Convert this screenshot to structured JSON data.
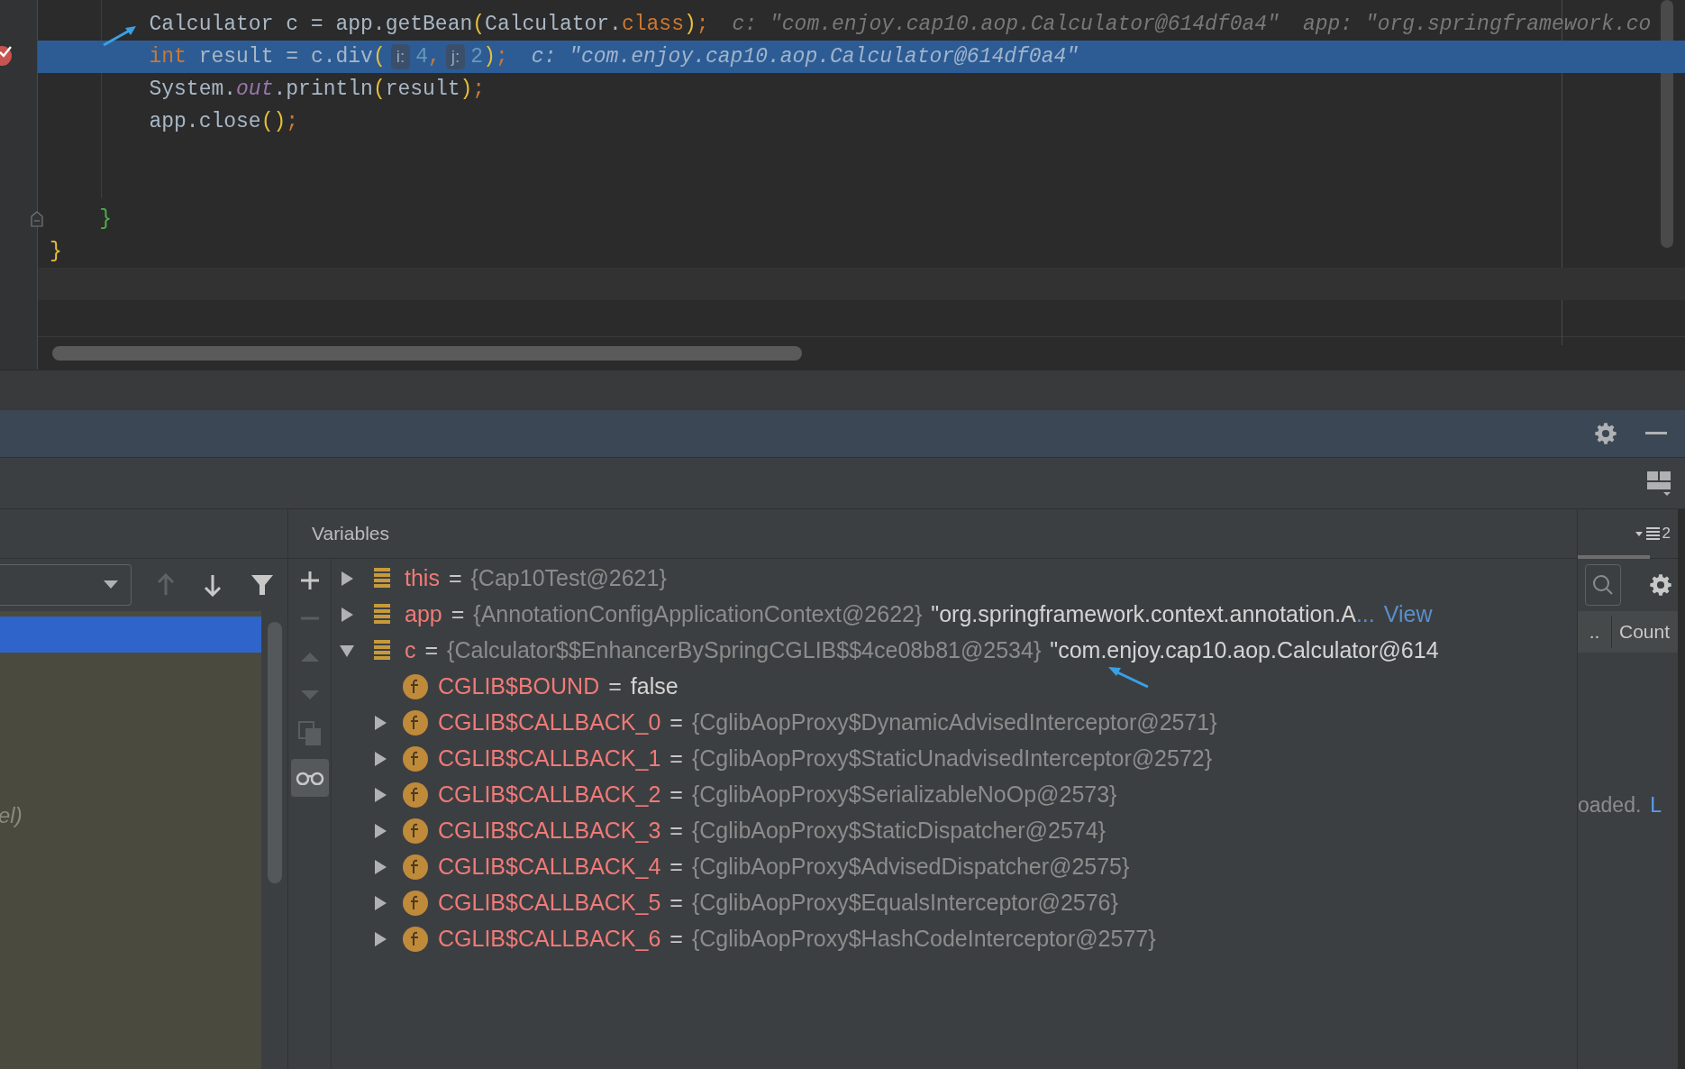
{
  "editor": {
    "lines": [
      {
        "highlighted": false,
        "tokens": [
          {
            "kind": "code",
            "text": "        Calculator c = app.getBean"
          },
          {
            "kind": "paren",
            "text": "("
          },
          {
            "kind": "code",
            "text": "Calculator."
          },
          {
            "kind": "keyword",
            "text": "class"
          },
          {
            "kind": "paren",
            "text": ")"
          },
          {
            "kind": "keyword",
            "text": ";"
          },
          {
            "kind": "inline_value",
            "text": "c: \"com.enjoy.cap10.aop.Calculator@614df0a4\""
          },
          {
            "kind": "inline_value",
            "text": "app: \"org.springframework.co"
          }
        ]
      },
      {
        "highlighted": true,
        "tokens": [
          {
            "kind": "keyword",
            "text": "        int"
          },
          {
            "kind": "code",
            "text": " result = c.div"
          },
          {
            "kind": "paren",
            "text": "("
          },
          {
            "kind": "param_hint",
            "text": "i:"
          },
          {
            "kind": "number",
            "text": "4"
          },
          {
            "kind": "keyword",
            "text": ","
          },
          {
            "kind": "param_hint",
            "text": "j:"
          },
          {
            "kind": "number",
            "text": "2"
          },
          {
            "kind": "paren",
            "text": ")"
          },
          {
            "kind": "keyword",
            "text": ";"
          },
          {
            "kind": "inline_value",
            "text": "c: \"com.enjoy.cap10.aop.Calculator@614df0a4\""
          }
        ]
      },
      {
        "highlighted": false,
        "tokens": [
          {
            "kind": "code",
            "text": "        System."
          },
          {
            "kind": "static",
            "text": "out"
          },
          {
            "kind": "code",
            "text": ".println"
          },
          {
            "kind": "paren",
            "text": "("
          },
          {
            "kind": "code",
            "text": "result"
          },
          {
            "kind": "paren",
            "text": ")"
          },
          {
            "kind": "keyword",
            "text": ";"
          }
        ]
      },
      {
        "highlighted": false,
        "tokens": [
          {
            "kind": "code",
            "text": "        app.close"
          },
          {
            "kind": "paren",
            "text": "()"
          },
          {
            "kind": "keyword",
            "text": ";"
          }
        ]
      },
      {
        "highlighted": false
      },
      {
        "highlighted": false
      },
      {
        "highlighted": false,
        "tokens": [
          {
            "kind": "brace_green",
            "text": "    }"
          }
        ]
      },
      {
        "highlighted": false,
        "tokens": [
          {
            "kind": "paren",
            "text": "}"
          }
        ]
      }
    ]
  },
  "frames": {
    "items": [
      {
        "selected": true
      },
      {
        "text": "el)",
        "selected": false
      }
    ]
  },
  "variables": {
    "title": "Variables",
    "items": [
      {
        "kind": "object",
        "name": "this",
        "expanded": false,
        "op": "=",
        "object": "{Cap10Test@2621}"
      },
      {
        "kind": "object",
        "name": "app",
        "expanded": false,
        "op": "=",
        "object": "{AnnotationConfigApplicationContext@2622}",
        "text": "\"org.springframework.context.annotation.A",
        "more": "...",
        "link": "View"
      },
      {
        "kind": "object",
        "name": "c",
        "expanded": true,
        "op": "=",
        "object": "{Calculator$$EnhancerBySpringCGLIB$$4ce08b81@2534}",
        "text": "\"com.enjoy.cap10.aop.Calculator@614",
        "children": [
          {
            "kind": "field",
            "name": "CGLIB$BOUND",
            "op": "=",
            "text": "false"
          },
          {
            "kind": "field",
            "name": "CGLIB$CALLBACK_0",
            "expanded": false,
            "op": "=",
            "object": "{CglibAopProxy$DynamicAdvisedInterceptor@2571}"
          },
          {
            "kind": "field",
            "name": "CGLIB$CALLBACK_1",
            "expanded": false,
            "op": "=",
            "object": "{CglibAopProxy$StaticUnadvisedInterceptor@2572}"
          },
          {
            "kind": "field",
            "name": "CGLIB$CALLBACK_2",
            "expanded": false,
            "op": "=",
            "object": "{CglibAopProxy$SerializableNoOp@2573}"
          },
          {
            "kind": "field",
            "name": "CGLIB$CALLBACK_3",
            "expanded": false,
            "op": "=",
            "object": "{CglibAopProxy$StaticDispatcher@2574}"
          },
          {
            "kind": "field",
            "name": "CGLIB$CALLBACK_4",
            "expanded": false,
            "op": "=",
            "object": "{CglibAopProxy$AdvisedDispatcher@2575}"
          },
          {
            "kind": "field",
            "name": "CGLIB$CALLBACK_5",
            "expanded": false,
            "op": "=",
            "object": "{CglibAopProxy$EqualsInterceptor@2576}"
          },
          {
            "kind": "field",
            "name": "CGLIB$CALLBACK_6",
            "expanded": false,
            "op": "=",
            "object": "{CglibAopProxy$HashCodeInterceptor@2577}"
          }
        ]
      }
    ]
  },
  "side_panel": {
    "count": "2",
    "columns": [
      "..",
      "Count"
    ],
    "message": "oaded.",
    "link": "L"
  }
}
